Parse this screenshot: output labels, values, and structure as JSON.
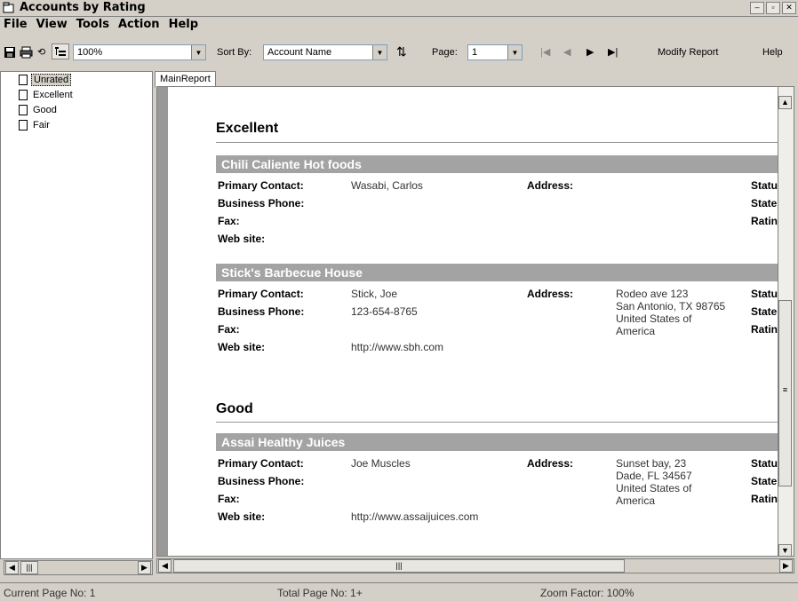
{
  "window": {
    "title": "Accounts by Rating"
  },
  "menu": [
    "File",
    "View",
    "Tools",
    "Action",
    "Help"
  ],
  "toolbar": {
    "zoom": "100%",
    "sort_label": "Sort By:",
    "sort_value": "Account Name",
    "page_label": "Page:",
    "page_value": "1",
    "modify_report": "Modify Report",
    "help": "Help"
  },
  "tree": {
    "items": [
      "Unrated",
      "Excellent",
      "Good",
      "Fair"
    ],
    "selected": "Unrated"
  },
  "tabs": [
    "MainReport"
  ],
  "report": {
    "sections": [
      {
        "title": "Excellent",
        "accounts": [
          {
            "name": "Chili Caliente Hot foods",
            "primary_contact": "Wasabi, Carlos",
            "business_phone": "",
            "fax": "",
            "web_site": "",
            "address": []
          },
          {
            "name": "Stick's Barbecue House",
            "primary_contact": "Stick, Joe",
            "business_phone": "123-654-8765",
            "fax": "",
            "web_site": "http://www.sbh.com",
            "address": [
              "Rodeo ave 123",
              "San Antonio, TX 98765",
              "United States of",
              "America"
            ]
          }
        ]
      },
      {
        "title": "Good",
        "accounts": [
          {
            "name": "Assai Healthy Juices",
            "primary_contact": "Joe Muscles",
            "business_phone": "",
            "fax": "",
            "web_site": "http://www.assaijuices.com",
            "address": [
              "Sunset bay, 23",
              "Dade, FL 34567",
              "United States of",
              "America"
            ]
          }
        ]
      }
    ],
    "labels": {
      "primary_contact": "Primary Contact:",
      "business_phone": "Business Phone:",
      "fax": "Fax:",
      "web_site": "Web site:",
      "address": "Address:",
      "status": "Statu",
      "state": "State",
      "rating": "Ratin"
    }
  },
  "status": {
    "current_page": "Current Page No: 1",
    "total_page": "Total Page No: 1+",
    "zoom_factor": "Zoom Factor: 100%"
  }
}
